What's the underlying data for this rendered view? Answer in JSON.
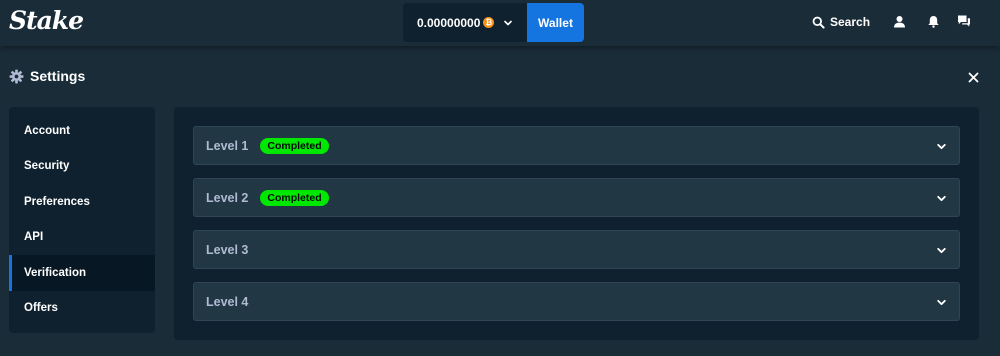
{
  "header": {
    "logo": "Stake",
    "balance": "0.00000000",
    "coin_symbol": "₿",
    "wallet_label": "Wallet",
    "search_label": "Search",
    "icons": [
      "search-icon",
      "user-icon",
      "bell-icon",
      "chat-icon",
      "chevron-down-icon"
    ]
  },
  "settings": {
    "title": "Settings",
    "icons": [
      "gear-icon",
      "close-icon"
    ]
  },
  "sidebar": {
    "items": [
      {
        "label": "Account"
      },
      {
        "label": "Security"
      },
      {
        "label": "Preferences"
      },
      {
        "label": "API"
      },
      {
        "label": "Verification",
        "active": true
      },
      {
        "label": "Offers"
      }
    ]
  },
  "levels": [
    {
      "label": "Level 1",
      "status": "Completed"
    },
    {
      "label": "Level 2",
      "status": "Completed"
    },
    {
      "label": "Level 3",
      "status": ""
    },
    {
      "label": "Level 4",
      "status": ""
    }
  ],
  "colors": {
    "background": "#1a2c38",
    "panel": "#0f212e",
    "row": "#213743",
    "accent": "#1475e1",
    "badge": "#00e701",
    "bitcoin": "#f7931a"
  }
}
